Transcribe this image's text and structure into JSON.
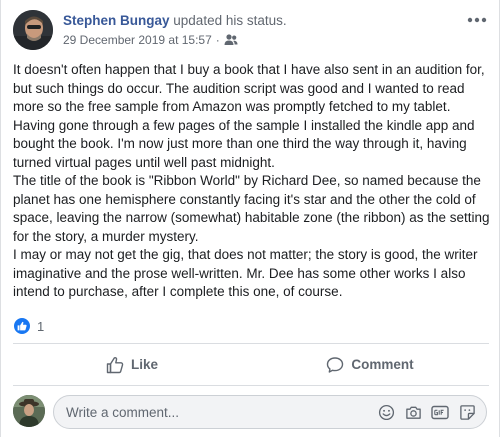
{
  "author": {
    "name": "Stephen Bungay",
    "action": "updated his status."
  },
  "meta": {
    "timestamp": "29 December 2019 at 15:57",
    "separator": "·",
    "audience_icon": "friends-icon"
  },
  "post": {
    "paragraphs": [
      "It doesn't often happen that I buy a book that I have also sent in an audition for, but such things do occur. The audition script was good and I wanted to read more so the free sample from Amazon was promptly fetched to my tablet. Having gone through a few pages of the sample I installed the kindle app and bought the book. I'm now just more than one third the way through it, having turned virtual pages until well past midnight.",
      "The title of the book is \"Ribbon World\" by Richard Dee, so named because the planet has one hemisphere constantly facing it's star and the other the cold of space, leaving the narrow (somewhat) habitable zone (the ribbon) as the setting for the story, a murder mystery.",
      "I may or may not get the gig, that does not matter; the story is good, the writer imaginative and the prose well-written. Mr. Dee has some other works I also intend to purchase, after I complete this one, of course."
    ]
  },
  "reactions": {
    "count": "1",
    "icon": "like-reaction-icon"
  },
  "actions": {
    "like_label": "Like",
    "comment_label": "Comment"
  },
  "composer": {
    "placeholder": "Write a comment...",
    "icons": [
      "emoji-icon",
      "camera-icon",
      "gif-icon",
      "sticker-icon"
    ]
  },
  "colors": {
    "brand_blue": "#1877f2",
    "author_link": "#385898",
    "secondary_text": "#606770"
  }
}
